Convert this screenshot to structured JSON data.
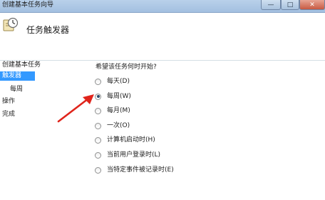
{
  "window": {
    "title": "创建基本任务向导",
    "minimize": "—",
    "maximize": "□",
    "close": "✕"
  },
  "header": {
    "title": "任务触发器",
    "icon": "clock-task-icon"
  },
  "nav": {
    "items": [
      {
        "label": "创建基本任务",
        "selected": false
      },
      {
        "label": "触发器",
        "selected": true
      },
      {
        "label": "每周",
        "selected": false
      },
      {
        "label": "操作",
        "selected": false
      },
      {
        "label": "完成",
        "selected": false
      }
    ]
  },
  "main": {
    "question": "希望该任务何时开始?",
    "selected_option": "每周(W)",
    "options": [
      {
        "label": "每天(D)"
      },
      {
        "label": "每周(W)"
      },
      {
        "label": "每月(M)"
      },
      {
        "label": "一次(O)"
      },
      {
        "label": "计算机启动时(H)"
      },
      {
        "label": "当前用户登录时(L)"
      },
      {
        "label": "当特定事件被记录时(E)"
      }
    ]
  },
  "annotation": {
    "arrow_color": "#e0241b"
  }
}
